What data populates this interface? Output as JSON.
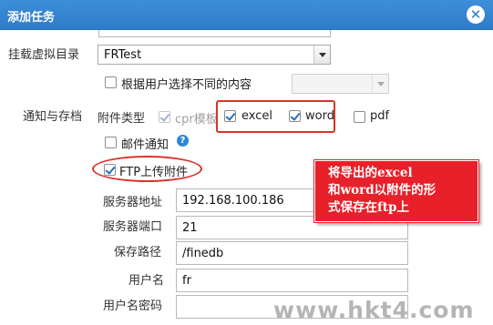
{
  "dialog": {
    "title": "添加任务",
    "close_icon": "close-circle-icon"
  },
  "mount_dir": {
    "label": "挂载虚拟目录",
    "value": "FRTest"
  },
  "by_user": {
    "label": "根据用户选择不同的内容",
    "checked": false,
    "select_value": ""
  },
  "notify": {
    "label": "通知与存档",
    "attach_type_label": "附件类型",
    "attachments": [
      {
        "label": "cpr模板",
        "checked": true,
        "disabled": true
      },
      {
        "label": "excel",
        "checked": true,
        "disabled": false
      },
      {
        "label": "word",
        "checked": true,
        "disabled": false
      },
      {
        "label": "pdf",
        "checked": false,
        "disabled": false
      }
    ],
    "email_label": "邮件通知",
    "email_checked": false,
    "help_icon": "help-icon",
    "ftp_label": "FTP上传附件",
    "ftp_checked": true
  },
  "ftp": {
    "server_label": "服务器地址",
    "server_value": "192.168.100.186",
    "port_label": "服务器端口",
    "port_value": "21",
    "path_label": "保存路径",
    "path_value": "/finedb",
    "user_label": "用户名",
    "user_value": "fr",
    "password_label": "用户名密码",
    "password_value": ""
  },
  "annotation": {
    "lines": [
      "将导出的excel",
      "和word以附件的形",
      "式保存在ftp上"
    ],
    "color": "#e8202a"
  },
  "watermark": "www.hkt4.com"
}
